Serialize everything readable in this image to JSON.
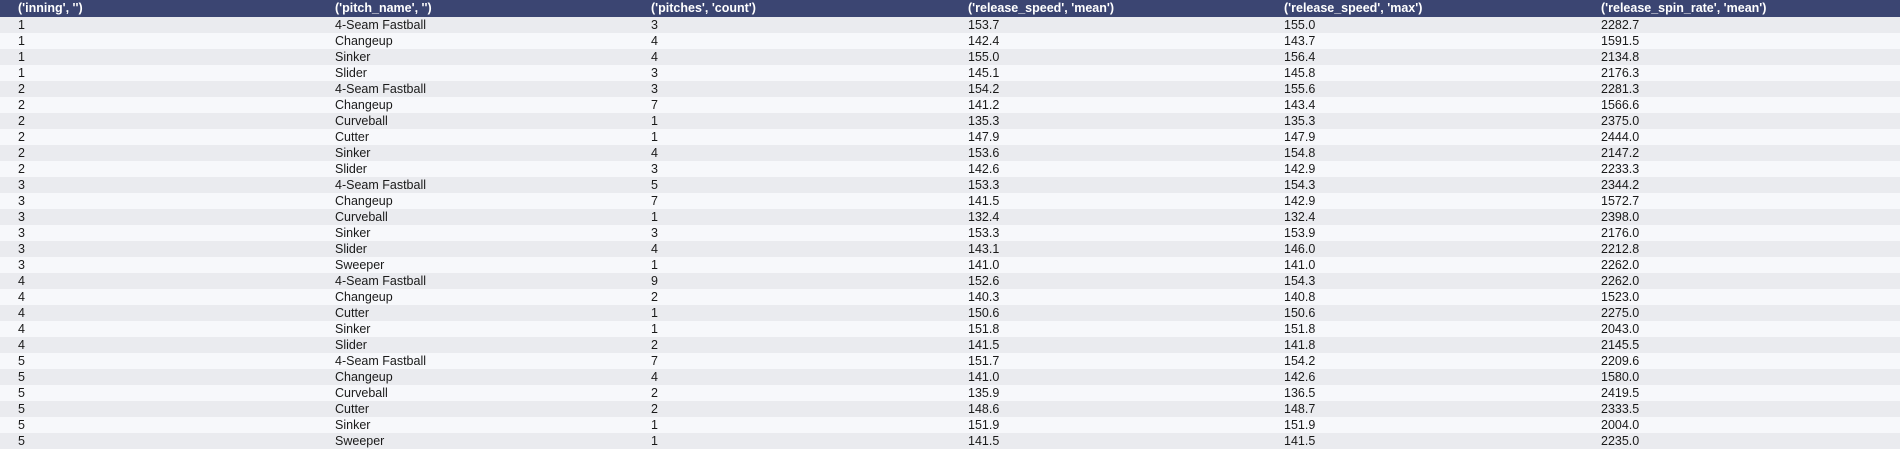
{
  "table": {
    "columns": [
      "('inning', '')",
      "('pitch_name', '')",
      "('pitches', 'count')",
      "('release_speed', 'mean')",
      "('release_speed', 'max')",
      "('release_spin_rate', 'mean')"
    ],
    "rows": [
      [
        "1",
        "4-Seam Fastball",
        "3",
        "153.7",
        "155.0",
        "2282.7"
      ],
      [
        "1",
        "Changeup",
        "4",
        "142.4",
        "143.7",
        "1591.5"
      ],
      [
        "1",
        "Sinker",
        "4",
        "155.0",
        "156.4",
        "2134.8"
      ],
      [
        "1",
        "Slider",
        "3",
        "145.1",
        "145.8",
        "2176.3"
      ],
      [
        "2",
        "4-Seam Fastball",
        "3",
        "154.2",
        "155.6",
        "2281.3"
      ],
      [
        "2",
        "Changeup",
        "7",
        "141.2",
        "143.4",
        "1566.6"
      ],
      [
        "2",
        "Curveball",
        "1",
        "135.3",
        "135.3",
        "2375.0"
      ],
      [
        "2",
        "Cutter",
        "1",
        "147.9",
        "147.9",
        "2444.0"
      ],
      [
        "2",
        "Sinker",
        "4",
        "153.6",
        "154.8",
        "2147.2"
      ],
      [
        "2",
        "Slider",
        "3",
        "142.6",
        "142.9",
        "2233.3"
      ],
      [
        "3",
        "4-Seam Fastball",
        "5",
        "153.3",
        "154.3",
        "2344.2"
      ],
      [
        "3",
        "Changeup",
        "7",
        "141.5",
        "142.9",
        "1572.7"
      ],
      [
        "3",
        "Curveball",
        "1",
        "132.4",
        "132.4",
        "2398.0"
      ],
      [
        "3",
        "Sinker",
        "3",
        "153.3",
        "153.9",
        "2176.0"
      ],
      [
        "3",
        "Slider",
        "4",
        "143.1",
        "146.0",
        "2212.8"
      ],
      [
        "3",
        "Sweeper",
        "1",
        "141.0",
        "141.0",
        "2262.0"
      ],
      [
        "4",
        "4-Seam Fastball",
        "9",
        "152.6",
        "154.3",
        "2262.0"
      ],
      [
        "4",
        "Changeup",
        "2",
        "140.3",
        "140.8",
        "1523.0"
      ],
      [
        "4",
        "Cutter",
        "1",
        "150.6",
        "150.6",
        "2275.0"
      ],
      [
        "4",
        "Sinker",
        "1",
        "151.8",
        "151.8",
        "2043.0"
      ],
      [
        "4",
        "Slider",
        "2",
        "141.5",
        "141.8",
        "2145.5"
      ],
      [
        "5",
        "4-Seam Fastball",
        "7",
        "151.7",
        "154.2",
        "2209.6"
      ],
      [
        "5",
        "Changeup",
        "4",
        "141.0",
        "142.6",
        "1580.0"
      ],
      [
        "5",
        "Curveball",
        "2",
        "135.9",
        "136.5",
        "2419.5"
      ],
      [
        "5",
        "Cutter",
        "2",
        "148.6",
        "148.7",
        "2333.5"
      ],
      [
        "5",
        "Sinker",
        "1",
        "151.9",
        "151.9",
        "2004.0"
      ],
      [
        "5",
        "Sweeper",
        "1",
        "141.5",
        "141.5",
        "2235.0"
      ]
    ]
  },
  "colors": {
    "header_bg": "#3b4572",
    "header_text": "#ffffff",
    "row_odd": "#eaebef",
    "row_even": "#f7f8fb"
  }
}
